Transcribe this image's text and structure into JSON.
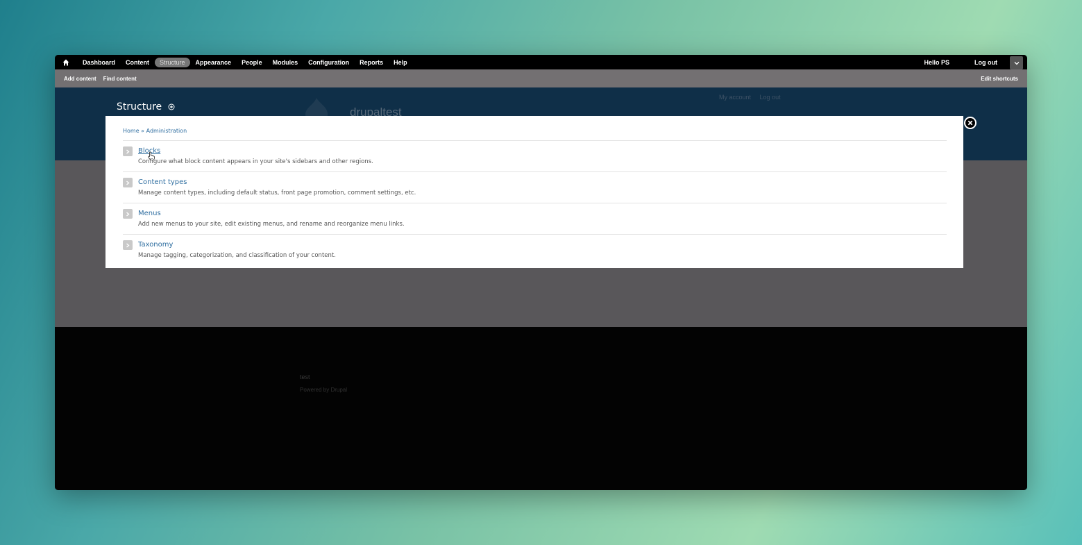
{
  "toolbar": {
    "items": [
      "Dashboard",
      "Content",
      "Structure",
      "Appearance",
      "People",
      "Modules",
      "Configuration",
      "Reports",
      "Help"
    ],
    "active": "Structure",
    "hello": "Hello PS",
    "logout": "Log out"
  },
  "shortcuts": {
    "add_content": "Add content",
    "find_content": "Find content",
    "edit_shortcuts": "Edit shortcuts"
  },
  "header": {
    "page_title": "Structure",
    "site_name": "drupaltest",
    "my_account": "My account",
    "log_out": "Log out"
  },
  "overlay": {
    "breadcrumb": "Home » Administration",
    "items": [
      {
        "title": "Blocks",
        "description": "Configure what block content appears in your site's sidebars and other regions."
      },
      {
        "title": "Content types",
        "description": "Manage content types, including default status, front page promotion, comment settings, etc."
      },
      {
        "title": "Menus",
        "description": "Add new menus to your site, edit existing menus, and rename and reorganize menu links."
      },
      {
        "title": "Taxonomy",
        "description": "Manage tagging, categorization, and classification of your content."
      }
    ]
  },
  "footer": {
    "site": "test",
    "powered": "Powered by Drupal"
  }
}
